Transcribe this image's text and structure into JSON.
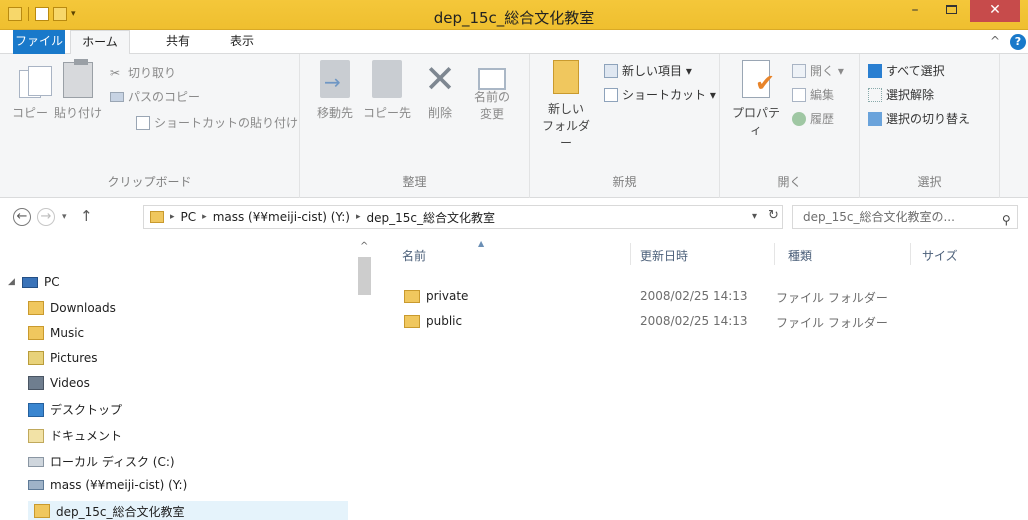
{
  "window": {
    "title": "dep_15c_総合文化教室",
    "minimize": "–",
    "close": "✕"
  },
  "tabs": {
    "file": "ファイル",
    "home": "ホーム",
    "share": "共有",
    "view": "表示",
    "collapse": "^",
    "help": "?"
  },
  "ribbon": {
    "clipboard": {
      "label": "クリップボード",
      "copy": "コピー",
      "paste": "貼り付け",
      "cut": "切り取り",
      "copy_path": "パスのコピー",
      "paste_shortcut": "ショートカットの貼り付け"
    },
    "organize": {
      "label": "整理",
      "move_to": "移動先",
      "copy_to": "コピー先",
      "delete": "削除",
      "rename_1": "名前の",
      "rename_2": "変更"
    },
    "new": {
      "label": "新規",
      "new_folder_1": "新しい",
      "new_folder_2": "フォルダー",
      "new_item": "新しい項目 ▾",
      "shortcut": "ショートカット ▾"
    },
    "open": {
      "label": "開く",
      "properties": "プロパティ",
      "open": "開く ▾",
      "edit": "編集",
      "history": "履歴"
    },
    "select": {
      "label": "選択",
      "select_all": "すべて選択",
      "select_none": "選択解除",
      "invert": "選択の切り替え"
    }
  },
  "address": {
    "crumbs": [
      "PC",
      "mass (¥¥meiji-cist) (Y:)",
      "dep_15c_総合文化教室"
    ],
    "search_placeholder": "dep_15c_総合文化教室の..."
  },
  "nav": {
    "items": [
      {
        "label": "PC",
        "icon": "pc-icon"
      },
      {
        "label": "Downloads",
        "icon": "downloads-folder-icon"
      },
      {
        "label": "Music",
        "icon": "music-folder-icon"
      },
      {
        "label": "Pictures",
        "icon": "pictures-folder-icon"
      },
      {
        "label": "Videos",
        "icon": "videos-folder-icon"
      },
      {
        "label": "デスクトップ",
        "icon": "desktop-folder-icon"
      },
      {
        "label": "ドキュメント",
        "icon": "documents-folder-icon"
      },
      {
        "label": "ローカル ディスク (C:)",
        "icon": "local-disk-icon"
      },
      {
        "label": "mass (¥¥meiji-cist) (Y:)",
        "icon": "network-drive-icon"
      },
      {
        "label": "dep_15c_総合文化教室",
        "icon": "folder-icon"
      }
    ]
  },
  "files": {
    "columns": {
      "name": "名前",
      "modified": "更新日時",
      "type": "種類",
      "size": "サイズ"
    },
    "rows": [
      {
        "name": "private",
        "modified": "2008/02/25 14:13",
        "type": "ファイル フォルダー",
        "size": ""
      },
      {
        "name": "public",
        "modified": "2008/02/25 14:13",
        "type": "ファイル フォルダー",
        "size": ""
      }
    ]
  },
  "colors": {
    "titlebar": "#f1c232",
    "file_tab": "#1979ca",
    "close_button": "#c74b4b",
    "selection": "#e5f3fb"
  }
}
